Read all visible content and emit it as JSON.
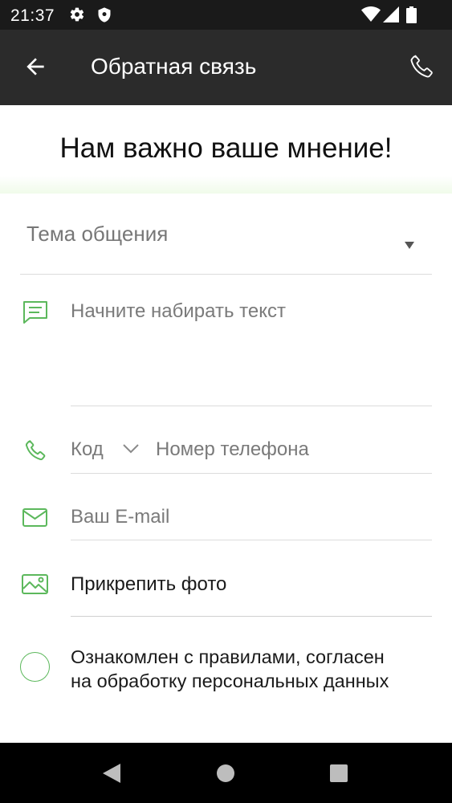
{
  "status_bar": {
    "time": "21:37"
  },
  "app_bar": {
    "title": "Обратная связь"
  },
  "hero": {
    "headline": "Нам важно ваше мнение!"
  },
  "form": {
    "topic_label": "Тема общения",
    "message_placeholder": "Начните набирать текст",
    "phone_code_label": "Код",
    "phone_number_placeholder": "Номер телефона",
    "email_placeholder": "Ваш E-mail",
    "attach_photo_label": "Прикрепить фото",
    "consent_line1": "Ознакомлен с правилами, согласен",
    "consent_line2": "на обработку персональных данных",
    "consent_checked": false
  },
  "colors": {
    "accent": "#5cb85c",
    "appbar": "#2b2b2b",
    "statusbar": "#1a1a1a"
  },
  "icons": [
    "gear-icon",
    "shield-icon",
    "wifi-icon",
    "signal-icon",
    "battery-icon",
    "back-arrow-icon",
    "phone-icon",
    "message-icon",
    "email-icon",
    "image-icon",
    "chevron-down-icon"
  ]
}
